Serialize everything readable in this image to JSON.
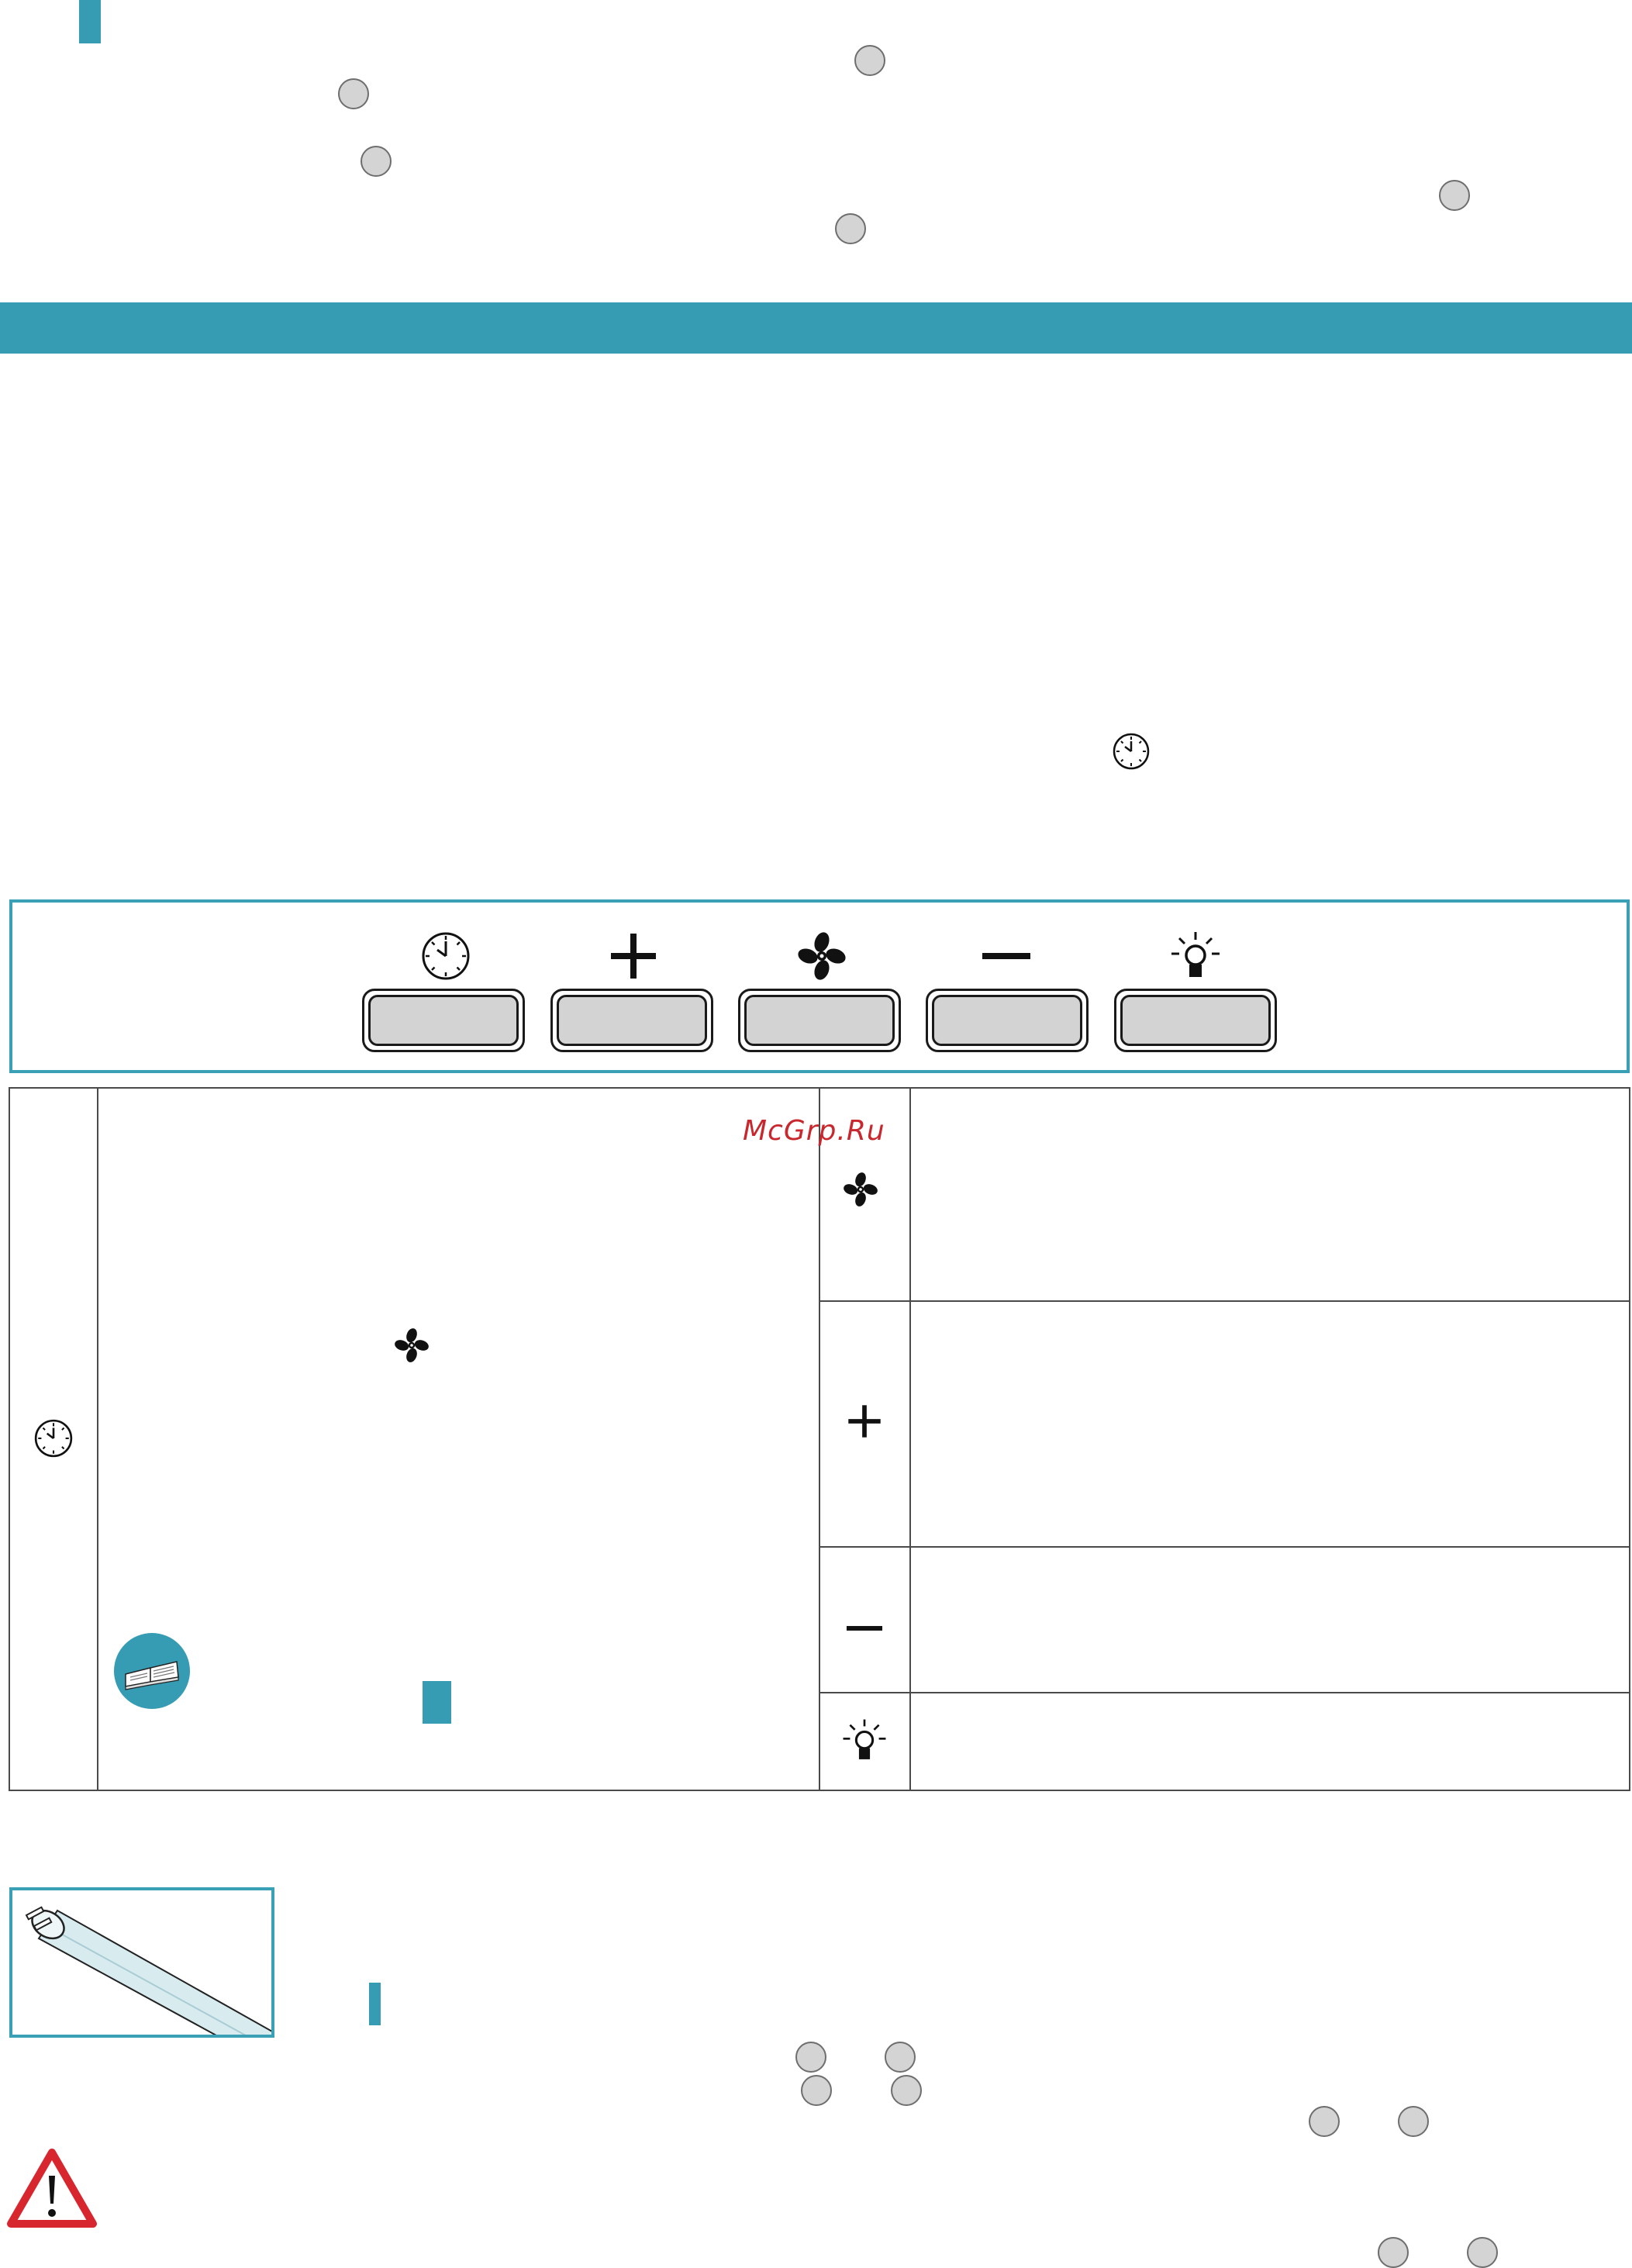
{
  "watermark": "McGrp.Ru",
  "colors": {
    "accent": "#369cb3",
    "watermark": "#c8282d",
    "button_fill": "#d3d3d3",
    "callout_fill": "#d4d4d4",
    "warning_red": "#d8262e"
  },
  "control_panel": {
    "buttons": [
      {
        "name": "timer",
        "icon": "clock-icon"
      },
      {
        "name": "plus",
        "icon": "plus-icon"
      },
      {
        "name": "fan",
        "icon": "fan-icon"
      },
      {
        "name": "minus",
        "icon": "minus-icon"
      },
      {
        "name": "light",
        "icon": "light-bulb-icon"
      }
    ]
  },
  "function_table": {
    "rows": [
      {
        "icon": "clock-icon"
      },
      {
        "icon": "fan-icon"
      },
      {
        "icon": "plus-icon"
      },
      {
        "icon": "minus-icon"
      },
      {
        "icon": "light-bulb-icon"
      }
    ]
  },
  "icons": {
    "book": "open-book-icon",
    "lamp": "fluorescent-tube-icon",
    "warning": "warning-triangle-icon"
  }
}
